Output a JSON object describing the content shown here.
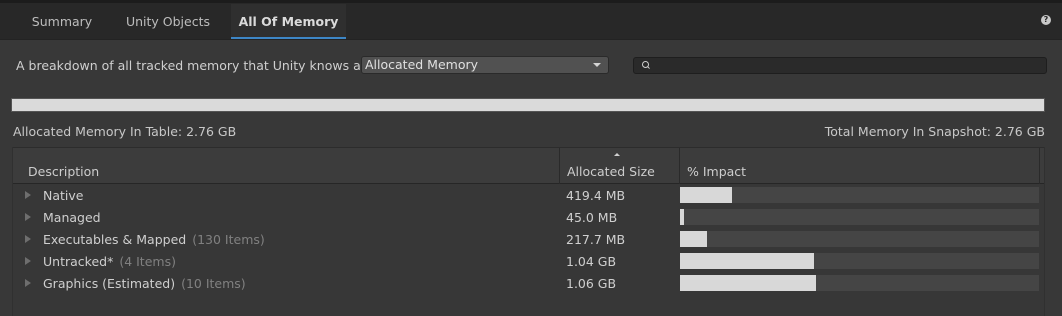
{
  "tabs": {
    "summary": "Summary",
    "unity_objects": "Unity Objects",
    "all_of_memory": "All Of Memory",
    "active": "All Of Memory"
  },
  "help_icon": "?",
  "description": "A breakdown of all tracked memory that Unity knows about.",
  "view_dropdown": {
    "selected": "Allocated Memory"
  },
  "search": {
    "value": "",
    "placeholder": ""
  },
  "summary": {
    "in_table": "Allocated Memory In Table: 2.76 GB",
    "total": "Total Memory In Snapshot: 2.76 GB",
    "total_bar_fraction": 1.0
  },
  "table": {
    "headers": {
      "description": "Description",
      "allocated_size": "Allocated Size",
      "impact": "% Impact"
    },
    "sort_column": "Allocated Size",
    "rows": [
      {
        "name": "Native",
        "count": "",
        "size": "419.4 MB",
        "impact_fraction": 0.144
      },
      {
        "name": "Managed",
        "count": "",
        "size": "45.0 MB",
        "impact_fraction": 0.011
      },
      {
        "name": "Executables & Mapped",
        "count": "(130 Items)",
        "size": "217.7 MB",
        "impact_fraction": 0.074
      },
      {
        "name": "Untracked*",
        "count": "(4 Items)",
        "size": "1.04 GB",
        "impact_fraction": 0.372
      },
      {
        "name": "Graphics (Estimated)",
        "count": "(10 Items)",
        "size": "1.06 GB",
        "impact_fraction": 0.379
      }
    ]
  },
  "colors": {
    "accent": "#3d86c6",
    "bar_fill": "#d8d8d8",
    "bar_track": "#454545"
  }
}
